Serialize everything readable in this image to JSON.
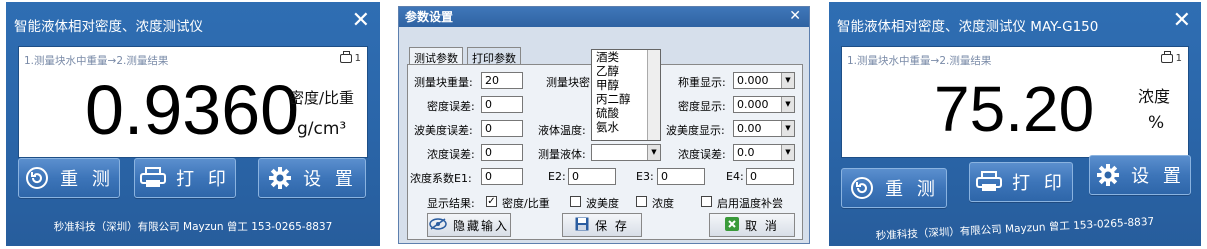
{
  "left": {
    "title": "智能液体相对密度、浓度测试仪",
    "close": "✕",
    "hint": "1.测量块水中重量→2.测量结果",
    "printer_count": "1",
    "value": "0.9360",
    "unit_top": "密度/比重",
    "unit_bottom": "g/cm³",
    "buttons": {
      "remeasure": "重 测",
      "print": "打 印",
      "settings": "设 置"
    },
    "footer": "秒准科技（深圳）有限公司 Mayzun 曾工 153-0265-8837"
  },
  "dialog": {
    "title": "参数设置",
    "close": "✕",
    "tabs": [
      "测试参数",
      "打印参数"
    ],
    "liquid_options": [
      "酒类",
      "乙醇",
      "甲醇",
      "丙二醇",
      "硫酸",
      "氨水"
    ],
    "fields": {
      "block_weight_label": "测量块重量:",
      "block_weight": "20",
      "block_label_partial": "测量块密",
      "density_error_label": "密度误差:",
      "density_error": "0",
      "baume_error_label": "波美度误差:",
      "baume_error": "0",
      "liquid_temp_label": "液体温度:",
      "liquid_temp": "0",
      "conc_error_label": "浓度误差:",
      "conc_error": "0",
      "measure_liquid_label": "测量液体:",
      "measure_liquid": "",
      "e1_label": "浓度系数E1:",
      "e1": "0",
      "e2_label": "E2:",
      "e2": "0",
      "e3_label": "E3:",
      "e3": "0",
      "e4_label": "E4:",
      "e4": "0",
      "weigh_display_label": "称重显示:",
      "weigh_display": "0.000",
      "density_display_label": "密度显示:",
      "density_display": "0.000",
      "baume_display_label": "波美度显示:",
      "baume_display": "0.00",
      "conc_error2_label": "浓度误差:",
      "conc_error2": "0.0"
    },
    "display_result_label": "显示结果:",
    "checks": [
      {
        "label": "密度/比重",
        "checked": true
      },
      {
        "label": "波美度",
        "checked": false
      },
      {
        "label": "浓度",
        "checked": false
      },
      {
        "label": "启用温度补尝",
        "checked": false
      }
    ],
    "buttons": {
      "hide_input": "隐藏输入",
      "save": "保 存",
      "cancel": "取 消"
    }
  },
  "right": {
    "title": "智能液体相对密度、浓度测试仪 MAY-G150",
    "close": "✕",
    "hint": "1.测量块水中重量→2.测量结果",
    "printer_count": "1",
    "value": "75.20",
    "unit_top": "浓度",
    "unit_bottom": "%",
    "buttons": {
      "remeasure": "重 测",
      "print": "打 印",
      "settings": "设 置"
    },
    "footer": "秒准科技（深圳）有限公司 Mayzun 曾工 153-0265-8837"
  }
}
